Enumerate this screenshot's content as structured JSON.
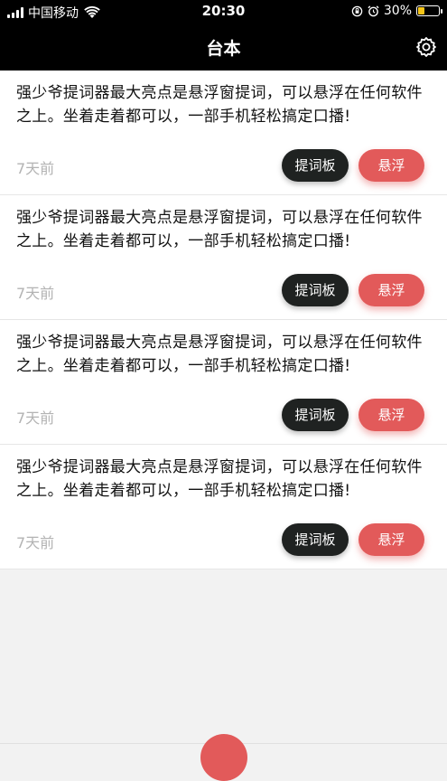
{
  "status_bar": {
    "carrier": "中国移动",
    "time": "20:30",
    "battery": "30%",
    "battery_color": "#f5c518"
  },
  "nav": {
    "title": "台本",
    "settings_icon": "gear-icon"
  },
  "scripts": [
    {
      "text": "强少爷提词器最大亮点是悬浮窗提词，可以悬浮在任何软件之上。坐着走着都可以，一部手机轻松搞定口播!",
      "time": "7天前",
      "prompter_label": "提词板",
      "float_label": "悬浮"
    },
    {
      "text": "强少爷提词器最大亮点是悬浮窗提词，可以悬浮在任何软件之上。坐着走着都可以，一部手机轻松搞定口播!",
      "time": "7天前",
      "prompter_label": "提词板",
      "float_label": "悬浮"
    },
    {
      "text": "强少爷提词器最大亮点是悬浮窗提词，可以悬浮在任何软件之上。坐着走着都可以，一部手机轻松搞定口播!",
      "time": "7天前",
      "prompter_label": "提词板",
      "float_label": "悬浮"
    },
    {
      "text": "强少爷提词器最大亮点是悬浮窗提词，可以悬浮在任何软件之上。坐着走着都可以，一部手机轻松搞定口播!",
      "time": "7天前",
      "prompter_label": "提词板",
      "float_label": "悬浮"
    }
  ],
  "colors": {
    "accent_red": "#e25a5a",
    "dark_button": "#1f2221",
    "header_bg": "#000000"
  }
}
